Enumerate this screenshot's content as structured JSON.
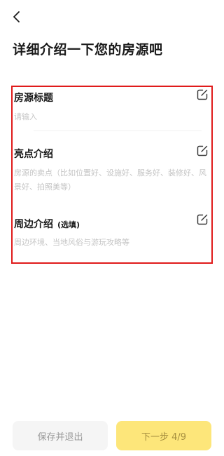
{
  "header": {
    "back_icon": "chevron-left-icon",
    "title": "详细介绍一下您的房源吧"
  },
  "form": {
    "title_section": {
      "label": "房源标题",
      "placeholder": "请输入",
      "icon": "edit-icon"
    },
    "highlights_section": {
      "label": "亮点介绍",
      "placeholder": "房源的卖点（比如位置好、设施好、服务好、装修好、风景好、拍照美等）",
      "icon": "edit-icon"
    },
    "surroundings_section": {
      "label": "周边介绍",
      "optional_tag": "(选填)",
      "placeholder": "周边环境、当地风俗与游玩攻略等",
      "icon": "edit-icon"
    }
  },
  "footer": {
    "save_exit_label": "保存并退出",
    "next_step_label": "下一步 4/9"
  },
  "colors": {
    "accent_yellow": "#fde67a",
    "annotation_red": "#e01b1b"
  }
}
